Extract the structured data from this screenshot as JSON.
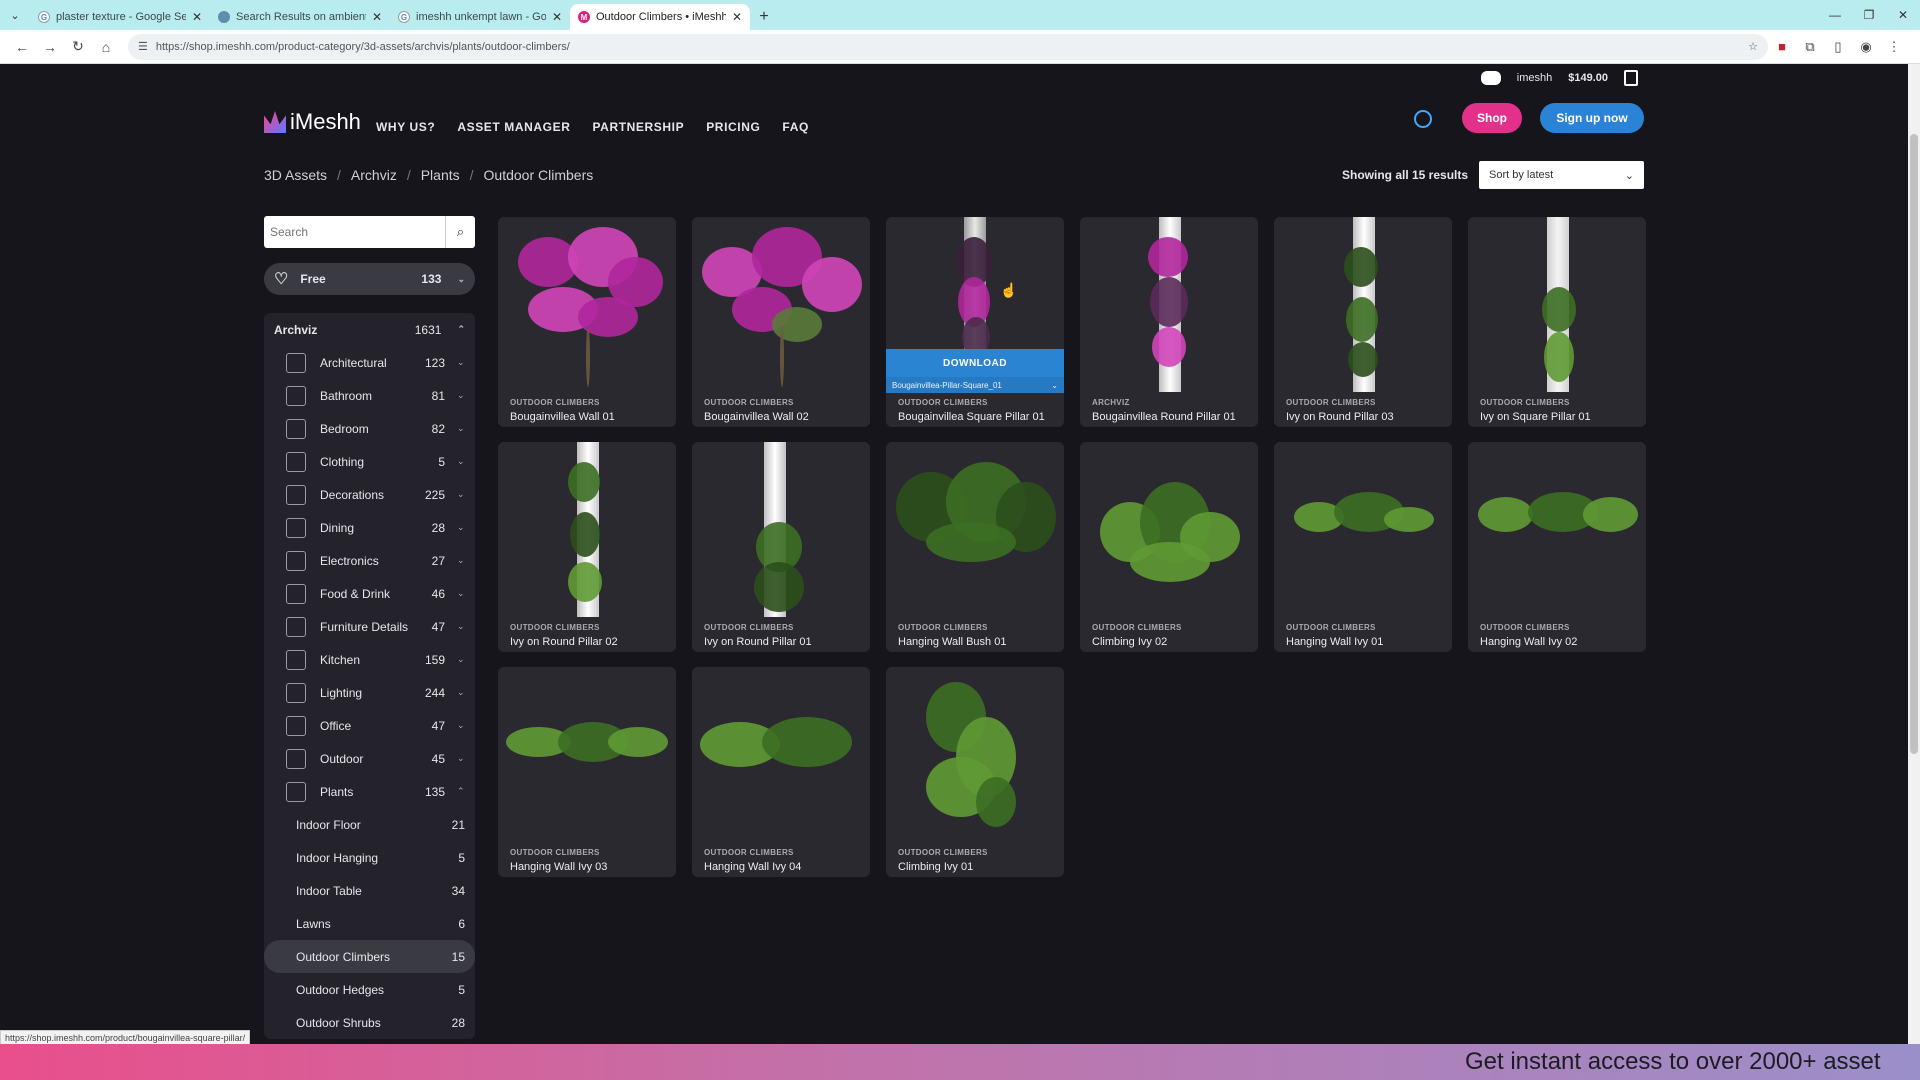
{
  "browser": {
    "tabs": [
      {
        "label": "plaster texture - Google Search",
        "icon": "google-icon"
      },
      {
        "label": "Search Results on ambientCG",
        "icon": "globe-icon"
      },
      {
        "label": "imeshh unkempt lawn - Google",
        "icon": "google-icon"
      },
      {
        "label": "Outdoor Climbers • iMeshh",
        "icon": "imeshh-icon"
      }
    ],
    "url": "https://shop.imeshh.com/product-category/3d-assets/archvis/plants/outdoor-climbers/"
  },
  "site": {
    "account": {
      "username": "imeshh",
      "cart_total": "$149.00"
    },
    "logo": "iMeshh",
    "nav": [
      "WHY US?",
      "ASSET MANAGER",
      "PARTNERSHIP",
      "PRICING",
      "FAQ"
    ],
    "shop_label": "Shop",
    "signup_label": "Sign up now",
    "breadcrumb": [
      "3D Assets",
      "Archviz",
      "Plants",
      "Outdoor Climbers"
    ],
    "results_text": "Showing all 15 results",
    "sort_value": "Sort by latest"
  },
  "sidebar": {
    "search_placeholder": "Search",
    "free": {
      "label": "Free",
      "count": "133"
    },
    "archviz": {
      "label": "Archviz",
      "count": "1631"
    },
    "categories": [
      {
        "label": "Architectural",
        "count": "123"
      },
      {
        "label": "Bathroom",
        "count": "81"
      },
      {
        "label": "Bedroom",
        "count": "82"
      },
      {
        "label": "Clothing",
        "count": "5"
      },
      {
        "label": "Decorations",
        "count": "225"
      },
      {
        "label": "Dining",
        "count": "28"
      },
      {
        "label": "Electronics",
        "count": "27"
      },
      {
        "label": "Food & Drink",
        "count": "46"
      },
      {
        "label": "Furniture Details",
        "count": "47"
      },
      {
        "label": "Kitchen",
        "count": "159"
      },
      {
        "label": "Lighting",
        "count": "244"
      },
      {
        "label": "Office",
        "count": "47"
      },
      {
        "label": "Outdoor",
        "count": "45"
      },
      {
        "label": "Plants",
        "count": "135"
      }
    ],
    "plant_subcategories": [
      {
        "label": "Indoor Floor",
        "count": "21"
      },
      {
        "label": "Indoor Hanging",
        "count": "5"
      },
      {
        "label": "Indoor Table",
        "count": "34"
      },
      {
        "label": "Lawns",
        "count": "6"
      },
      {
        "label": "Outdoor Climbers",
        "count": "15"
      },
      {
        "label": "Outdoor Hedges",
        "count": "5"
      },
      {
        "label": "Outdoor Shrubs",
        "count": "28"
      }
    ]
  },
  "products": [
    {
      "category": "OUTDOOR CLIMBERS",
      "title": "Bougainvillea Wall 01"
    },
    {
      "category": "OUTDOOR CLIMBERS",
      "title": "Bougainvillea Wall 02"
    },
    {
      "category": "OUTDOOR CLIMBERS",
      "title": "Bougainvillea Square Pillar 01"
    },
    {
      "category": "ARCHVIZ",
      "title": "Bougainvillea Round Pillar 01"
    },
    {
      "category": "OUTDOOR CLIMBERS",
      "title": "Ivy on Round Pillar 03"
    },
    {
      "category": "OUTDOOR CLIMBERS",
      "title": "Ivy on Square Pillar 01"
    },
    {
      "category": "OUTDOOR CLIMBERS",
      "title": "Ivy on Round Pillar 02"
    },
    {
      "category": "OUTDOOR CLIMBERS",
      "title": "Ivy on Round Pillar 01"
    },
    {
      "category": "OUTDOOR CLIMBERS",
      "title": "Hanging Wall Bush 01"
    },
    {
      "category": "OUTDOOR CLIMBERS",
      "title": "Climbing Ivy 02"
    },
    {
      "category": "OUTDOOR CLIMBERS",
      "title": "Hanging Wall Ivy 01"
    },
    {
      "category": "OUTDOOR CLIMBERS",
      "title": "Hanging Wall Ivy 02"
    },
    {
      "category": "OUTDOOR CLIMBERS",
      "title": "Hanging Wall Ivy 03"
    },
    {
      "category": "OUTDOOR CLIMBERS",
      "title": "Hanging Wall Ivy 04"
    },
    {
      "category": "OUTDOOR CLIMBERS",
      "title": "Climbing Ivy 01"
    }
  ],
  "hover_card": {
    "download_label": "DOWNLOAD",
    "variant_value": "Bougainvillea-Pillar-Square_01"
  },
  "status_url": "https://shop.imeshh.com/product/bougainvillea-square-pillar/",
  "promo_text": "Get instant access to over 2000+ asset",
  "colors": {
    "accent_pink": "#e2308b",
    "accent_blue": "#2a83d6",
    "bg": "#16151c",
    "card": "#2a2930"
  }
}
